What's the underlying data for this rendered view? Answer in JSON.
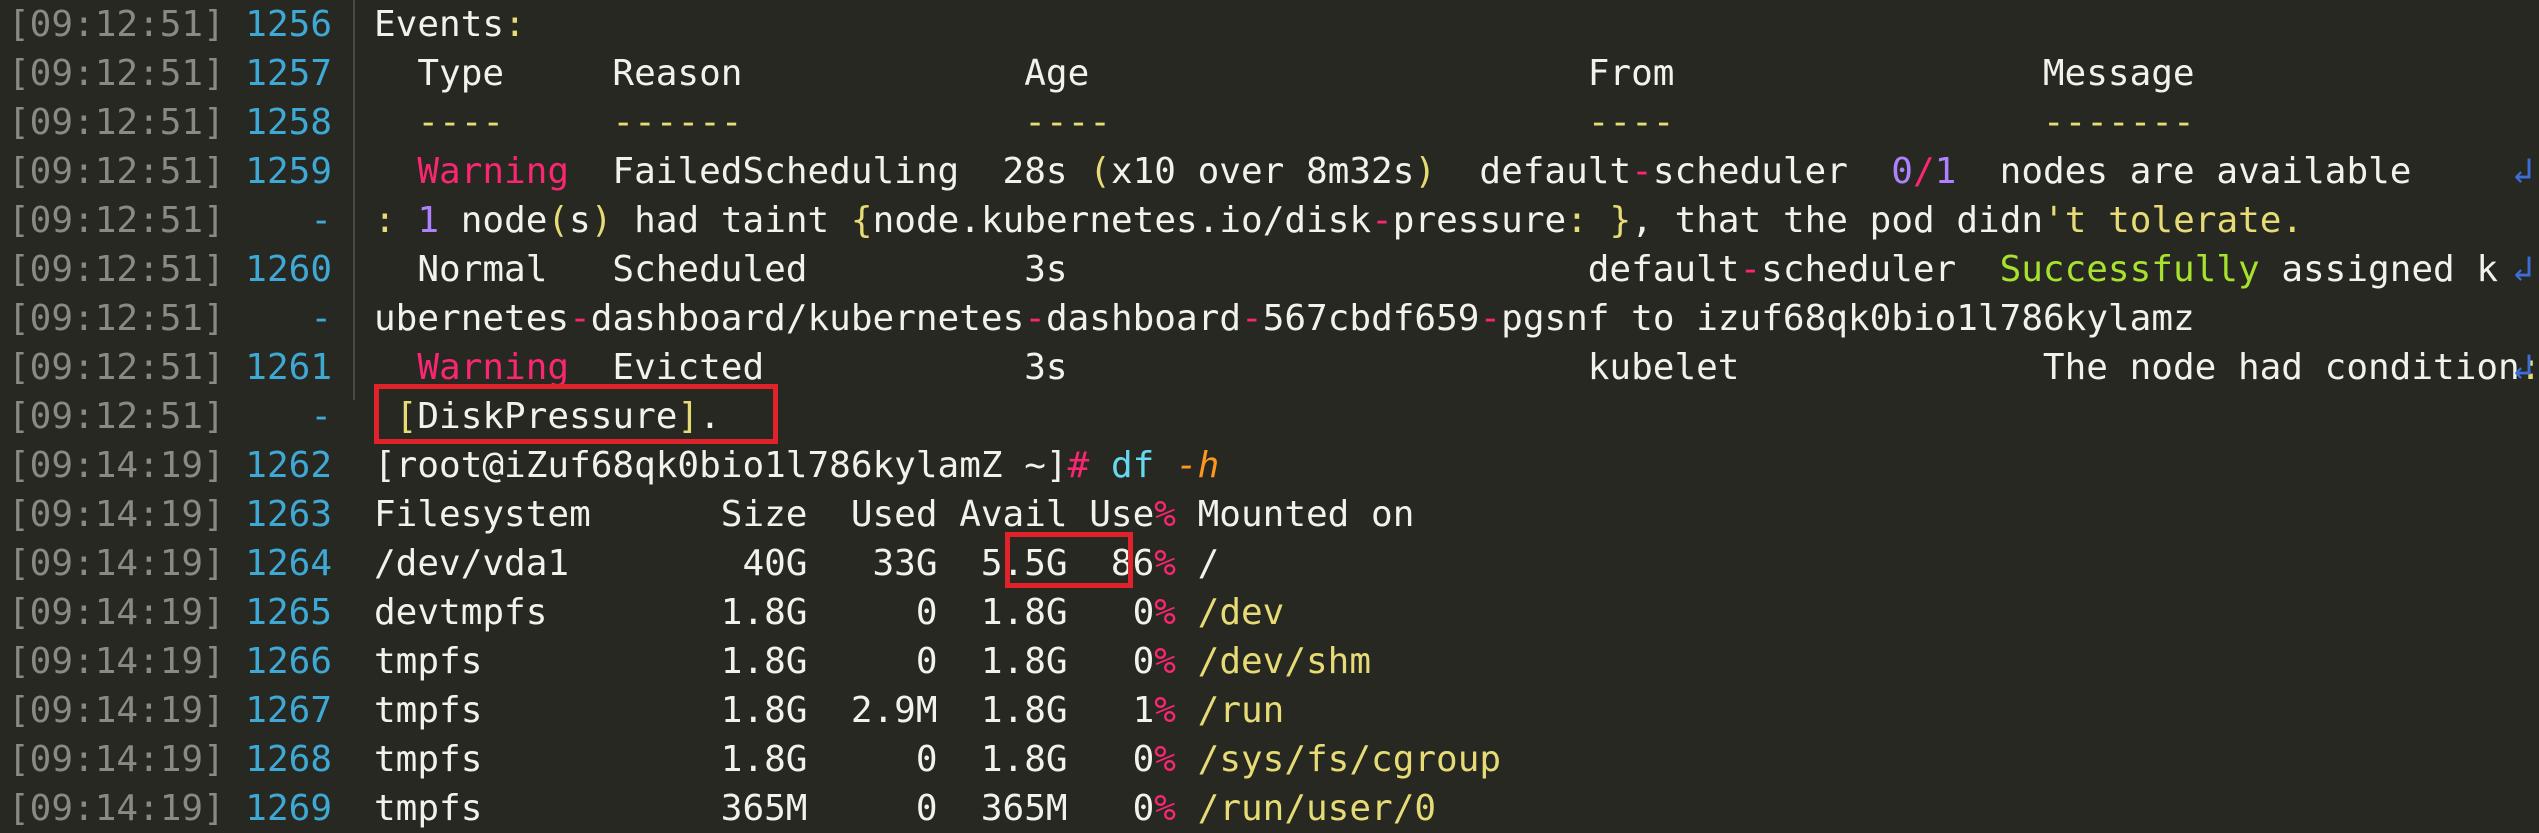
{
  "lines": [
    {
      "ts": "[09:12:51]",
      "num": "1256",
      "segs": [
        [
          "",
          "Events"
        ],
        [
          "yellow",
          ":"
        ]
      ]
    },
    {
      "ts": "[09:12:51]",
      "num": "1257",
      "segs": [
        [
          "",
          "  Type     Reason             Age                       From                 Message"
        ]
      ]
    },
    {
      "ts": "[09:12:51]",
      "num": "1258",
      "segs": [
        [
          "",
          "  "
        ],
        [
          "yellow",
          "----     ------             ----                      ----                 -------"
        ]
      ]
    },
    {
      "ts": "[09:12:51]",
      "num": "1259",
      "segs": [
        [
          "",
          "  "
        ],
        [
          "red",
          "Warning"
        ],
        [
          "",
          "  FailedScheduling  28s "
        ],
        [
          "yellow",
          "("
        ],
        [
          "",
          "x10 over 8m32s"
        ],
        [
          "yellow",
          ")"
        ],
        [
          "",
          "  default"
        ],
        [
          "red",
          "-"
        ],
        [
          "",
          "scheduler  "
        ],
        [
          "purple",
          "0"
        ],
        [
          "red",
          "/"
        ],
        [
          "purple",
          "1"
        ],
        [
          "",
          "  nodes are available"
        ]
      ]
    },
    {
      "ts": "[09:12:51]",
      "num": "-",
      "segs": [
        [
          "yellow",
          ":"
        ],
        [
          "",
          ""
        ],
        [
          "purple",
          " 1"
        ],
        [
          "",
          " node"
        ],
        [
          "yellow",
          "("
        ],
        [
          "",
          "s"
        ],
        [
          "yellow",
          ")"
        ],
        [
          "",
          " had taint "
        ],
        [
          "yellow",
          "{"
        ],
        [
          "",
          "node.kubernetes.io/disk"
        ],
        [
          "red",
          "-"
        ],
        [
          "",
          "pressure"
        ],
        [
          "yellow",
          ":"
        ],
        [
          "",
          " "
        ],
        [
          "yellow",
          "}"
        ],
        [
          "",
          ", that the pod didn"
        ],
        [
          "yellow",
          "'t tolerate."
        ]
      ]
    },
    {
      "ts": "[09:12:51]",
      "num": "1260",
      "segs": [
        [
          "",
          "  Normal   Scheduled          3s                        default"
        ],
        [
          "red",
          "-"
        ],
        [
          "",
          "scheduler  "
        ],
        [
          "green",
          "Successfully"
        ],
        [
          "",
          " assigned k"
        ]
      ]
    },
    {
      "ts": "[09:12:51]",
      "num": "-",
      "segs": [
        [
          "",
          "ubernetes"
        ],
        [
          "red",
          "-"
        ],
        [
          "",
          "dashboard/kubernetes"
        ],
        [
          "red",
          "-"
        ],
        [
          "",
          "dashboard"
        ],
        [
          "red",
          "-"
        ],
        [
          "",
          "567cbdf659"
        ],
        [
          "red",
          "-"
        ],
        [
          "",
          "pgsnf to izuf68qk0bio1l786kylamz"
        ]
      ]
    },
    {
      "ts": "[09:12:51]",
      "num": "1261",
      "segs": [
        [
          "",
          "  "
        ],
        [
          "red",
          "Warning"
        ],
        [
          "",
          "  Evicted            3s                        kubelet              The node had condition"
        ],
        [
          "yellow",
          ":"
        ]
      ]
    },
    {
      "ts": "[09:12:51]",
      "num": "-",
      "segs": [
        [
          "",
          ""
        ],
        [
          "yellow",
          " ["
        ],
        [
          "",
          "DiskPressure"
        ],
        [
          "yellow",
          "]"
        ],
        [
          "",
          "."
        ]
      ]
    },
    {
      "ts": "[09:14:19]",
      "num": "1262",
      "segs": [
        [
          "",
          "[root@iZuf68qk0bio1l786kylamZ ~]"
        ],
        [
          "red",
          "#"
        ],
        [
          "",
          " "
        ],
        [
          "cyan",
          "df"
        ],
        [
          "",
          " "
        ],
        [
          "orange",
          "-h"
        ]
      ]
    },
    {
      "ts": "[09:14:19]",
      "num": "1263",
      "segs": [
        [
          "",
          "Filesystem      Size  Used Avail Use"
        ],
        [
          "red",
          "%"
        ],
        [
          "",
          " Mounted on"
        ]
      ]
    },
    {
      "ts": "[09:14:19]",
      "num": "1264",
      "segs": [
        [
          "",
          "/dev/vda1        40G   33G  5.5G  86"
        ],
        [
          "red",
          "%"
        ],
        [
          "",
          " /"
        ]
      ]
    },
    {
      "ts": "[09:14:19]",
      "num": "1265",
      "segs": [
        [
          "",
          "devtmpfs        1.8G     0  1.8G   0"
        ],
        [
          "red",
          "%"
        ],
        [
          "",
          " "
        ],
        [
          "yellow",
          "/dev"
        ]
      ]
    },
    {
      "ts": "[09:14:19]",
      "num": "1266",
      "segs": [
        [
          "",
          "tmpfs           1.8G     0  1.8G   0"
        ],
        [
          "red",
          "%"
        ],
        [
          "",
          " "
        ],
        [
          "yellow",
          "/dev/shm"
        ]
      ]
    },
    {
      "ts": "[09:14:19]",
      "num": "1267",
      "segs": [
        [
          "",
          "tmpfs           1.8G  2.9M  1.8G   1"
        ],
        [
          "red",
          "%"
        ],
        [
          "",
          " "
        ],
        [
          "yellow",
          "/run"
        ]
      ]
    },
    {
      "ts": "[09:14:19]",
      "num": "1268",
      "segs": [
        [
          "",
          "tmpfs           1.8G     0  1.8G   0"
        ],
        [
          "red",
          "%"
        ],
        [
          "",
          " "
        ],
        [
          "yellow",
          "/sys/fs/cgroup"
        ]
      ]
    },
    {
      "ts": "[09:14:19]",
      "num": "1269",
      "segs": [
        [
          "",
          "tmpfs           365M     0  365M   0"
        ],
        [
          "red",
          "%"
        ],
        [
          "",
          " "
        ],
        [
          "yellow",
          "/run/user/0"
        ]
      ]
    }
  ],
  "wrap_marker": "↲",
  "colors": {
    "background": "#272822",
    "highlight_box": "#e0232a"
  }
}
